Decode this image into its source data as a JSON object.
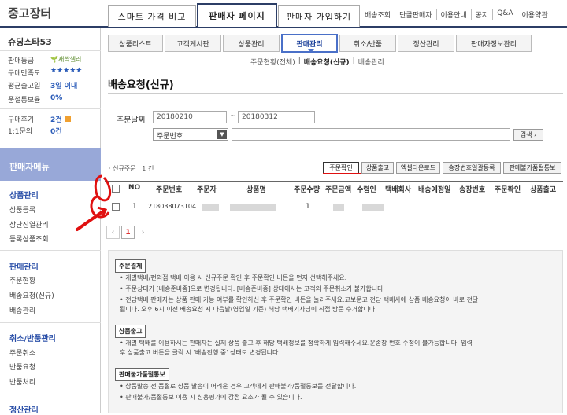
{
  "brand": "중고장터",
  "main_tabs": [
    "스마트 가격 비교",
    "판매자 페이지",
    "판매자 가입하기"
  ],
  "top_links": [
    "배송조회",
    "단골판매자",
    "이용안내",
    "공지",
    "Q&A",
    "이용약관"
  ],
  "seller": {
    "name": "슈딩스타53",
    "rows": [
      {
        "label": "판매등급",
        "value": "새싹셀러"
      },
      {
        "label": "구매만족도",
        "value": "★★★★★"
      },
      {
        "label": "평균출고일",
        "value": "3일 이내"
      },
      {
        "label": "품절통보율",
        "value": "0%"
      },
      {
        "label": "구매후기",
        "value": "2건"
      },
      {
        "label": "1:1문의",
        "value": "0건"
      }
    ]
  },
  "sidebar": {
    "menu_title": "판매자메뉴",
    "groups": [
      {
        "title": "상품관리",
        "items": [
          "상품등록",
          "상단진열관리",
          "등록상품조회"
        ]
      },
      {
        "title": "판매관리",
        "items": [
          "주문현황",
          "배송요청(신규)",
          "배송관리"
        ]
      },
      {
        "title": "취소/반품관리",
        "items": [
          "주문취소",
          "반품요청",
          "반품처리"
        ]
      },
      {
        "title": "정산관리",
        "items": []
      }
    ]
  },
  "sub_tabs": [
    "상품리스트",
    "고객게시판",
    "상품관리",
    "판매관리",
    "취소/반품",
    "정산관리",
    "판매자정보관리"
  ],
  "sub_sub": [
    "주문현황(전체)",
    "배송요청(신규)",
    "배송관리"
  ],
  "page_title": "배송요청(신규)",
  "filter": {
    "date_label": "주문날짜",
    "date_from": "20180210",
    "tilde": "~",
    "date_to": "20180312",
    "select_value": "주문번호",
    "search_button": "검색 ›"
  },
  "count_text": "· 신규주문 : 1 건",
  "actions": [
    "주문확인",
    "상품출고",
    "엑셀다운로드",
    "송장번호일괄등록",
    "판매불가품절통보"
  ],
  "table": {
    "headers": [
      "NO",
      "주문번호",
      "주문자",
      "상품명",
      "주문수량",
      "주문금액",
      "수령인",
      "택배회사",
      "배송예정일",
      "송장번호",
      "주문확인",
      "상품출고"
    ],
    "rows": [
      {
        "no": "1",
        "order_no": "218038073104",
        "qty": "1"
      }
    ]
  },
  "pager": [
    "‹",
    "1",
    "›"
  ],
  "notices": [
    {
      "title": "주문결제",
      "lines": [
        "• 개별택배/편의점 택배 이용 시 신규주문 확인 후 주문확인 버튼을 먼저 선택해주세요.",
        "• 주문상태가 [배송준비중]으로 변경됩니다. [배송준비중] 상태에서는 고객의 주문취소가 불가합니다",
        "• 전담택배 판매자는 상품 판매 가능 여부를 확인하신 후 주문확인 버튼을 눌러주세요.고보문고 전담 택배사에 상품 배송요청이 바로 전달",
        "  됩니다. 오후 6시 이전 배송요청 시 다음날(영업일 기준) 해당 택배기사님이 직접 방문 수거합니다."
      ]
    },
    {
      "title": "상품출고",
      "lines": [
        "• 개별 택배를 이용하시는 판매자는 실제 상품 출고 후 해당 택배정보를 정확하게 입력해주세요.운송장 번호 수정이 불가능합니다. 입력",
        "  후 상품출고 버튼을 클릭 시 '배송진행 중' 상태로 변경됩니다."
      ]
    },
    {
      "title": "판매불가품절통보",
      "lines": [
        "• 상품발송 전 품절로 상품 발송이 어려운 경우 고객에게 판매불가/품절통보를 전달합니다.",
        "• 판매불가/품절통보 이용 시 신용평가에 감점 요소가 될 수 있습니다."
      ]
    }
  ]
}
